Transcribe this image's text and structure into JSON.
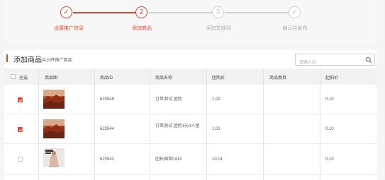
{
  "stepper": {
    "steps": [
      {
        "label": "设置推广信息",
        "icon": "✓",
        "state": "done"
      },
      {
        "label": "添加商品",
        "icon": "2",
        "state": "done"
      },
      {
        "label": "添加关键词",
        "icon": "3",
        "state": "pending"
      },
      {
        "label": "确认并发布",
        "icon": "✓",
        "state": "pending"
      }
    ]
  },
  "section": {
    "title": "添加商品",
    "subtitle": "共10件推广商品",
    "search_placeholder": "请输入ID"
  },
  "table": {
    "columns": {
      "select_all": "全选",
      "image": "商品图",
      "id": "商品ID",
      "name": "商品名称",
      "group_price": "团购价",
      "category": "商品类目",
      "start_bid": "起拍价"
    },
    "rows": [
      {
        "checked": true,
        "image": "desert-canyon",
        "id": "623549",
        "name": "订单测试 团危",
        "group_price": "1.02",
        "category": "",
        "start_bid": "0.10"
      },
      {
        "checked": true,
        "image": "desert-canyon",
        "id": "623544",
        "name": "订单测试 团危1元4人团",
        "group_price": "1.01",
        "category": "",
        "start_bid": "0.10"
      },
      {
        "checked": false,
        "image": "fashion-magazine",
        "id": "623542",
        "name": "团长国单0413",
        "group_price": "10.01",
        "category": "",
        "start_bid": "0.10"
      }
    ]
  },
  "colors": {
    "accent": "#e9432f",
    "pending": "#d3d3d3"
  }
}
